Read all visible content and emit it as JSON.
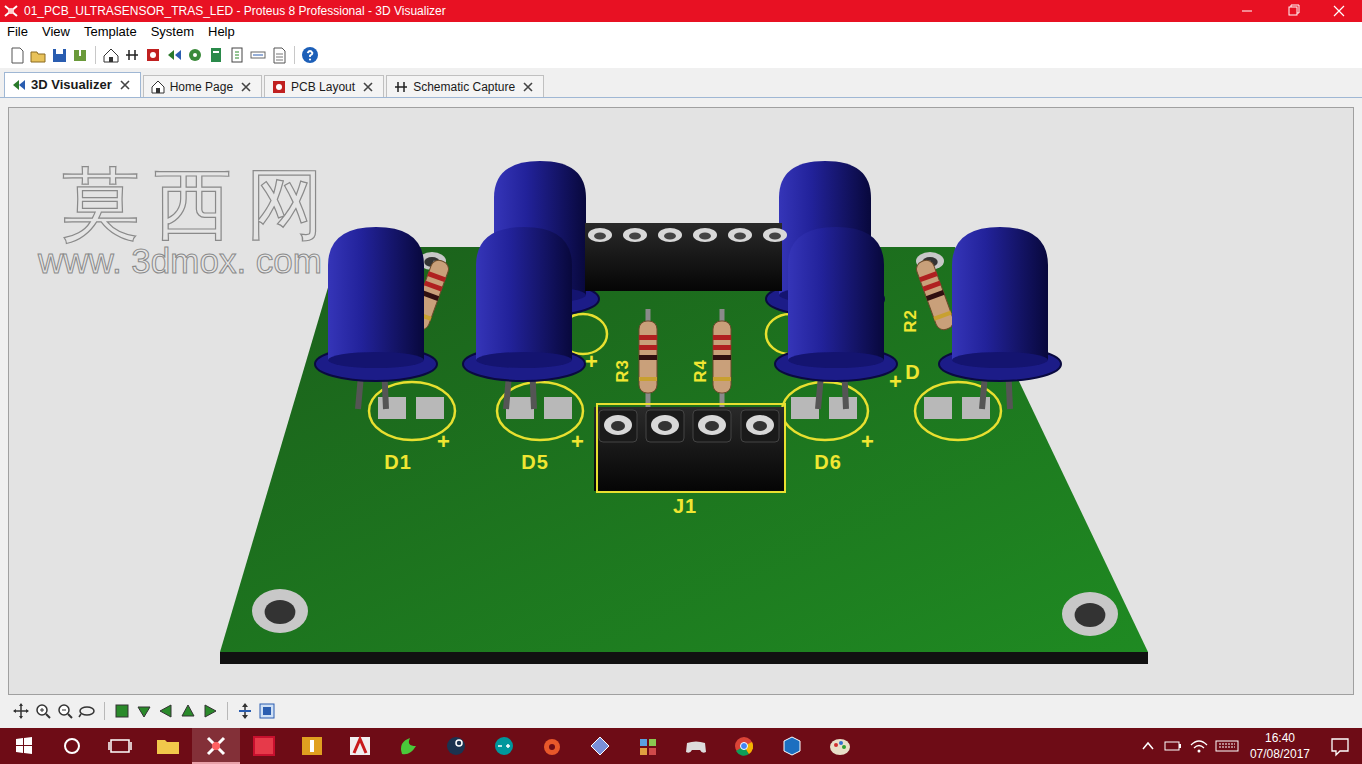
{
  "window": {
    "title": "01_PCB_ULTRASENSOR_TRAS_LED - Proteus 8 Professional - 3D Visualizer"
  },
  "menu": [
    "File",
    "View",
    "Template",
    "System",
    "Help"
  ],
  "tabs": [
    {
      "label": "3D Visualizer",
      "selected": true
    },
    {
      "label": "Home Page",
      "selected": false
    },
    {
      "label": "PCB Layout",
      "selected": false
    },
    {
      "label": "Schematic Capture",
      "selected": false
    }
  ],
  "viewer": {
    "watermark": {
      "title": "莫西网",
      "url": "www. 3dmox. com"
    },
    "labels": [
      {
        "text": "D1"
      },
      {
        "text": "D5"
      },
      {
        "text": "D6"
      },
      {
        "text": "J1"
      },
      {
        "text": "R3"
      },
      {
        "text": "R4"
      },
      {
        "text": "R2"
      },
      {
        "text": "+"
      },
      {
        "text": "+"
      },
      {
        "text": "+"
      },
      {
        "text": "+"
      },
      {
        "text": "+"
      },
      {
        "text": "D"
      }
    ]
  },
  "taskbar": {
    "time": "16:40",
    "date": "07/08/2017"
  }
}
